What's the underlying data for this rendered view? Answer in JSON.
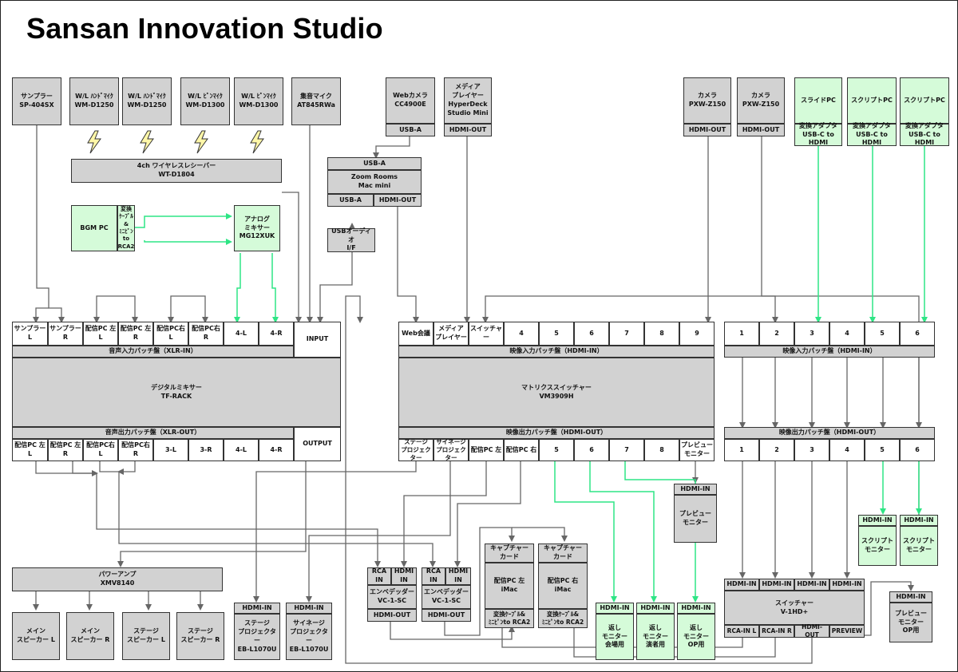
{
  "title": "Sansan Innovation Studio",
  "colors": {
    "line": "#666666",
    "green_line": "#2ee585",
    "box": "#d2d2d2",
    "green_box": "#d5fbd9",
    "white_box": "#ffffff"
  },
  "sources": {
    "sampler": "サンプラー\nSP-404SX",
    "wl_hand1": "W/L ﾊﾝﾄﾞﾏｲｸ\nWM-D1250",
    "wl_hand2": "W/L ﾊﾝﾄﾞﾏｲｸ\nWM-D1250",
    "wl_pin1": "W/L ﾋﾟﾝﾏｲｸ\nWM-D1300",
    "wl_pin2": "W/L ﾋﾟﾝﾏｲｸ\nWM-D1300",
    "group_mic": "集音マイク\nAT845RWa",
    "webcam": "Webカメラ\nCC4900E",
    "webcam_port": "USB-A",
    "media_player": "メディア\nプレイヤー\nHyperDeck\nStudio Mini",
    "media_player_port": "HDMI-OUT",
    "camera1": "カメラ\nPXW-Z150",
    "camera1_port": "HDMI-OUT",
    "camera2": "カメラ\nPXW-Z150",
    "camera2_port": "HDMI-OUT",
    "slide_pc": "スライドPC",
    "slide_pc_adapter": "変換アダプタ\nUSB-C to HDMI",
    "script_pc1": "スクリプトPC",
    "script_pc1_adapter": "変換アダプタ\nUSB-C to HDMI",
    "script_pc2": "スクリプトPC",
    "script_pc2_adapter": "変換アダプタ\nUSB-C to HDMI"
  },
  "receiver": "4ch ワイヤレスレシーバー\nWT-D1804",
  "zoom": {
    "port_top": "USB-A",
    "name": "Zoom Rooms\nMac mini",
    "port_usb": "USB-A",
    "port_hdmi": "HDMI-OUT"
  },
  "bgm_pc": {
    "name": "BGM PC",
    "cable": "変換\nｹｰﾌﾞﾙ&\nﾐﾆﾋﾟﾝ\nto\nRCA2"
  },
  "analog_mixer": "アナログ\nミキサー\nMG12XUK",
  "usb_audio": "USBオーディオ\nI/F",
  "audio_in_patch": {
    "ports": [
      "サンプラー\nL",
      "サンプラー\nR",
      "配信PC 左\nL",
      "配信PC 左\nR",
      "配信PC右\nL",
      "配信PC右\nR",
      "4-L",
      "4-R"
    ],
    "input": "INPUT",
    "label": "音声入力パッチ盤（XLR-IN）"
  },
  "digital_mixer": "デジタルミキサー\nTF-RACK",
  "audio_out_patch": {
    "label": "音声出力パッチ盤（XLR-OUT）",
    "ports": [
      "配信PC 左\nL",
      "配信PC 左\nR",
      "配信PC右\nL",
      "配信PC右\nR",
      "3-L",
      "3-R",
      "4-L",
      "4-R"
    ],
    "output": "OUTPUT"
  },
  "video_in_patch1": {
    "ports": [
      "Web会議",
      "メディア\nプレイヤー",
      "スイッチャ\nー",
      "4",
      "5",
      "6",
      "7",
      "8",
      "9"
    ],
    "label": "映像入力パッチ盤（HDMI-IN）"
  },
  "matrix": "マトリクススイッチャー\nVM3909H",
  "video_out_patch1": {
    "label": "映像出力パッチ盤（HDMI-OUT）",
    "ports": [
      "ステージ\nプロジェク\nター",
      "サイネージ\nプロジェク\nター",
      "配信PC 左",
      "配信PC 右",
      "5",
      "6",
      "7",
      "8",
      "プレビュー\nモニター"
    ]
  },
  "video_in_patch2": {
    "ports": [
      "1",
      "2",
      "3",
      "4",
      "5",
      "6"
    ],
    "label": "映像入力パッチ盤（HDMI-IN）"
  },
  "video_out_patch2": {
    "label": "映像出力パッチ盤（HDMI-OUT）",
    "ports": [
      "1",
      "2",
      "3",
      "4",
      "5",
      "6"
    ]
  },
  "power_amp": "パワーアンプ\nXMV8140",
  "speakers": [
    "メイン\nスピーカー L",
    "メイン\nスピーカー R",
    "ステージ\nスピーカー L",
    "ステージ\nスピーカー R"
  ],
  "stage_projector": {
    "port": "HDMI-IN",
    "name": "ステージ\nプロジェクター\nEB-L1070U"
  },
  "signage_projector": {
    "port": "HDMI-IN",
    "name": "サイネージ\nプロジェクター\nEB-L1070U"
  },
  "embedder1": {
    "rca": "RCA\nIN",
    "hdmi": "HDMI\nIN",
    "name": "エンベデッダー\nVC-1-SC",
    "out": "HDMI-OUT"
  },
  "embedder2": {
    "rca": "RCA\nIN",
    "hdmi": "HDMI\nIN",
    "name": "エンベデッダー\nVC-1-SC",
    "out": "HDMI-OUT"
  },
  "capture_left": {
    "top": "キャプチャー\nカード",
    "name": "配信PC 左\niMac",
    "bottom": "変換ｹｰﾌﾞﾙ&\nﾐﾆﾋﾟﾝto RCA2"
  },
  "capture_right": {
    "top": "キャプチャー\nカード",
    "name": "配信PC 右\niMac",
    "bottom": "変換ｹｰﾌﾞﾙ&\nﾐﾆﾋﾟﾝto RCA2"
  },
  "return_monitors": [
    {
      "port": "HDMI-IN",
      "name": "返し\nモニター\n会場用"
    },
    {
      "port": "HDMI-IN",
      "name": "返し\nモニター\n演者用"
    },
    {
      "port": "HDMI-IN",
      "name": "返し\nモニター\nOP用"
    }
  ],
  "preview_monitor": {
    "port": "HDMI-IN",
    "name": "プレビュー\nモニター"
  },
  "script_monitors": [
    {
      "port": "HDMI-IN",
      "name": "スクリプト\nモニター"
    },
    {
      "port": "HDMI-IN",
      "name": "スクリプト\nモニター"
    }
  ],
  "switcher": {
    "inputs": [
      "HDMI-IN",
      "HDMI-IN",
      "HDMI-IN",
      "HDMI-IN"
    ],
    "name": "スイッチャー\nV-1HD+",
    "outputs": [
      "RCA-IN L",
      "RCA-IN R",
      "HDMI-OUT",
      "PREVIEW"
    ]
  },
  "preview_op": {
    "port": "HDMI-IN",
    "name": "プレビュー\nモニター\nOP用"
  },
  "icons": {
    "wireless": "lightning-bolt-icon"
  }
}
